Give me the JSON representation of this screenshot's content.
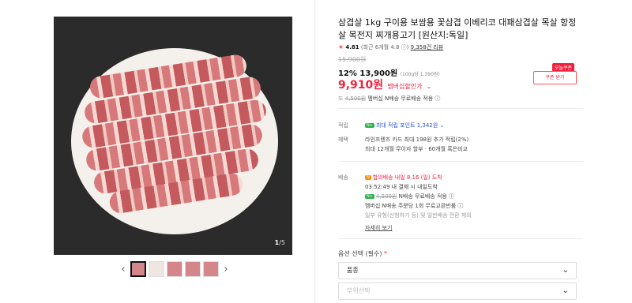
{
  "product": {
    "title": "삼겹살 1kg 구이용 보쌈용 꽃삼겹 이베리코 대패삼겹살 목살 항정살 목전지 찌개용고기 [원산지:독일]",
    "rating": "4.81",
    "rating_recent": "(최근 6개월 4.8",
    "review_count": "9,358건 리뷰",
    "original_price": "15,900원",
    "discount_rate": "12%",
    "sale_price": "13,900원",
    "unit_price": "(100g당 1,390원)",
    "member_price": "9,910원",
    "member_price_label": "멤버십할인가",
    "coupon_tag": "오늘쿠폰",
    "coupon_button": "쿠폰 받기",
    "shipping_note_prefix": "또",
    "shipping_note_strike": "4,500원",
    "shipping_note": "멤버십 N배송 무료배송 적용"
  },
  "gallery": {
    "current": "1",
    "total": "/5"
  },
  "points": {
    "label": "적립",
    "badge": "N+",
    "text": "최대 적립 포인트 1,342원"
  },
  "benefits": {
    "label": "혜택",
    "lines": [
      "라인프렌즈 카드 최대 198원 추가 적립(2%)",
      "최대 12개월 무이자 할부 · 60개월 혹은비교"
    ]
  },
  "delivery": {
    "label": "배송",
    "badge": "N",
    "type": "합의배송",
    "eta": "내일 8.16 (일) 도착",
    "cutoff": "03:52:49 내 결제 시 내일도착",
    "member_strike": "4,500원",
    "member_note": "N배송 무료배송 적용",
    "exchange": "멤버십 N배송 주문당 1회 무료교환반품",
    "exclude": "일부 유형(신청하기 등) 및 일반배송 전환 제외",
    "detail_link": "자세히 보기"
  },
  "options": {
    "label": "옵션 선택 (필수)",
    "required_mark": "*",
    "select1": "품종",
    "select2": "부위선택"
  }
}
